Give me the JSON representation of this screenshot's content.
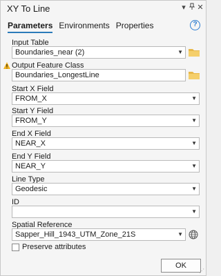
{
  "window": {
    "title": "XY To Line"
  },
  "tabs": [
    "Parameters",
    "Environments",
    "Properties"
  ],
  "help_icon": "question-circle-icon",
  "params": {
    "input_table": {
      "label": "Input Table",
      "value": "Boundaries_near (2)"
    },
    "output_fc": {
      "label": "Output Feature Class",
      "value": "Boundaries_LongestLine",
      "warning_icon": "warning-triangle-icon"
    },
    "start_x": {
      "label": "Start X Field",
      "value": "FROM_X"
    },
    "start_y": {
      "label": "Start Y Field",
      "value": "FROM_Y"
    },
    "end_x": {
      "label": "End X Field",
      "value": "NEAR_X"
    },
    "end_y": {
      "label": "End Y Field",
      "value": "NEAR_Y"
    },
    "line_type": {
      "label": "Line Type",
      "value": "Geodesic"
    },
    "id": {
      "label": "ID",
      "value": ""
    },
    "spatial_ref": {
      "label": "Spatial Reference",
      "value": "Sapper_Hill_1943_UTM_Zone_21S"
    },
    "preserve": {
      "label": "Preserve attributes",
      "checked": false
    }
  },
  "buttons": {
    "ok": "OK"
  },
  "colors": {
    "accent": "#2b7bb9",
    "folder": "#e8b84a",
    "warning": "#f0b323"
  }
}
